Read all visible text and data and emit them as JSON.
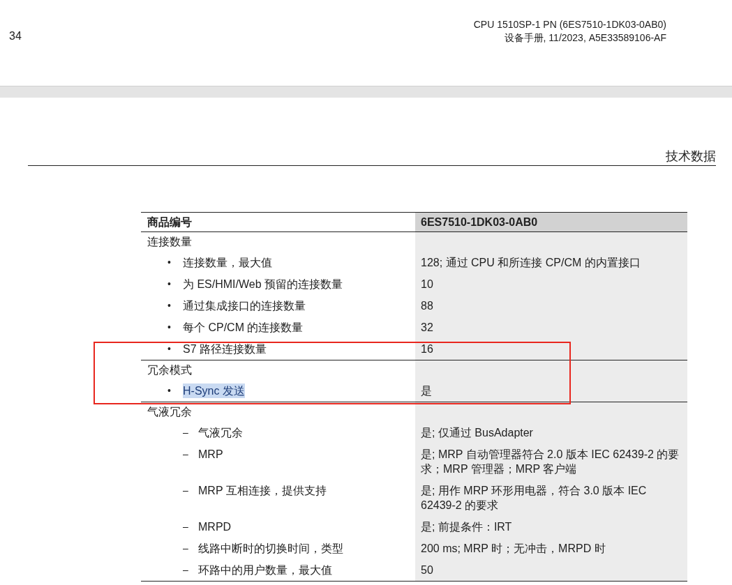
{
  "header": {
    "page_number": "34",
    "title": "CPU 1510SP-1 PN (6ES7510-1DK03-0AB0)",
    "subtitle": "设备手册, 11/2023, A5E33589106-AF"
  },
  "section_title": "技术数据",
  "table": {
    "header": [
      "商品编号",
      "6ES7510-1DK03-0AB0"
    ],
    "groups": [
      {
        "title": "连接数量",
        "items": [
          {
            "kind": "bullet",
            "marker": "•",
            "label": "连接数量，最大值",
            "value": "128; 通过 CPU 和所连接 CP/CM 的内置接口",
            "highlighted": false
          },
          {
            "kind": "bullet",
            "marker": "•",
            "label": "为 ES/HMI/Web 预留的连接数量",
            "value": "10",
            "highlighted": false
          },
          {
            "kind": "bullet",
            "marker": "•",
            "label": "通过集成接口的连接数量",
            "value": "88",
            "highlighted": false
          },
          {
            "kind": "bullet",
            "marker": "•",
            "label": "每个 CP/CM 的连接数量",
            "value": "32",
            "highlighted": false
          },
          {
            "kind": "bullet",
            "marker": "•",
            "label": "S7 路径连接数量",
            "value": "16",
            "highlighted": false
          }
        ]
      },
      {
        "title": "冗余模式",
        "items": [
          {
            "kind": "bullet",
            "marker": "•",
            "label": "H-Sync 发送",
            "value": "是",
            "highlighted": true
          }
        ]
      },
      {
        "title": "气液冗余",
        "items": [
          {
            "kind": "dash",
            "marker": "–",
            "label": "气液冗余",
            "value": "是; 仅通过 BusAdapter",
            "highlighted": false
          },
          {
            "kind": "dash",
            "marker": "–",
            "label": "MRP",
            "value": "是; MRP 自动管理器符合 2.0 版本 IEC 62439-2 的要求；MRP 管理器；MRP 客户端",
            "highlighted": false
          },
          {
            "kind": "dash",
            "marker": "–",
            "label": "MRP 互相连接，提供支持",
            "value": "是; 用作 MRP 环形用电器，符合 3.0 版本 IEC 62439-2 的要求",
            "highlighted": false
          },
          {
            "kind": "dash",
            "marker": "–",
            "label": "MRPD",
            "value": "是; 前提条件：IRT",
            "highlighted": false
          },
          {
            "kind": "dash",
            "marker": "–",
            "label": "线路中断时的切换时间，类型",
            "value": "200 ms; MRP 时；无冲击，MRPD 时",
            "highlighted": false
          },
          {
            "kind": "dash",
            "marker": "–",
            "label": "环路中的用户数量，最大值",
            "value": "50",
            "highlighted": false
          }
        ]
      }
    ]
  }
}
